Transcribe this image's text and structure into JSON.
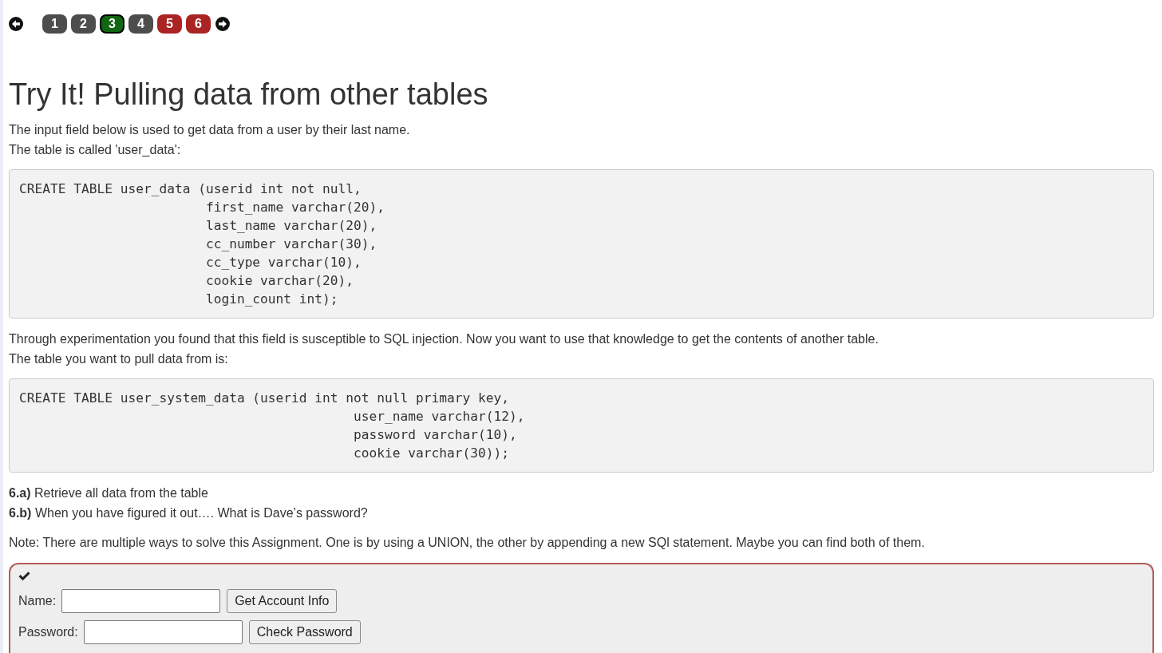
{
  "pagination": {
    "pages": [
      {
        "label": "1",
        "color": "#4d4d4d",
        "selected": false
      },
      {
        "label": "2",
        "color": "#4d4d4d",
        "selected": false
      },
      {
        "label": "3",
        "color": "#116611",
        "selected": true
      },
      {
        "label": "4",
        "color": "#4d4d4d",
        "selected": false
      },
      {
        "label": "5",
        "color": "#aa2424",
        "selected": false
      },
      {
        "label": "6",
        "color": "#aa2424",
        "selected": false
      }
    ]
  },
  "title": "Try It! Pulling data from other tables",
  "intro": [
    "The input field below is used to get data from a user by their last name.",
    "The table is called 'user_data':"
  ],
  "code_1": "CREATE TABLE user_data (userid int not null,\n                        first_name varchar(20),\n                        last_name varchar(20),\n                        cc_number varchar(30),\n                        cc_type varchar(10),\n                        cookie varchar(20),\n                        login_count int);",
  "description": [
    "Through experimentation you found that this field is susceptible to SQL injection. Now you want to use that knowledge to get the contents of another table.",
    "The table you want to pull data from is:"
  ],
  "code_2": "CREATE TABLE user_system_data (userid int not null primary key,\n                                           user_name varchar(12),\n                                           password varchar(10),\n                                           cookie varchar(30));",
  "tasks": [
    "**6.a)** Retrieve all data from the table",
    "**6.b)** When you have figured it out…. What is Dave’s password?"
  ],
  "note": "Note: There are multiple ways to solve this Assignment. One is by using a UNION, the other by appending a new SQl statement. Maybe you can find both of them.",
  "form": {
    "rows": [
      {
        "label": "Name:",
        "button": "Get Account Info"
      },
      {
        "label": "Password:",
        "button": "Check Password"
      }
    ]
  }
}
